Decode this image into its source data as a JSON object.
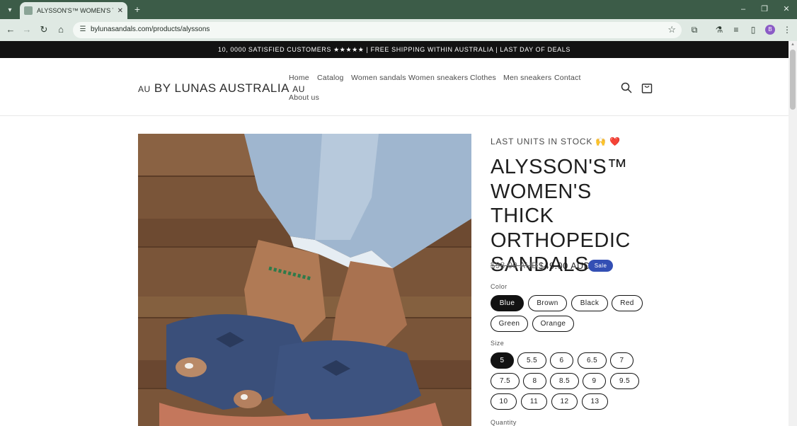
{
  "browser": {
    "tab_title": "ALYSSON'S™ WOMEN'S THICK",
    "tab_close": "✕",
    "new_tab": "+",
    "url": "bylunasandals.com/products/alyssons",
    "profile_initial": "B"
  },
  "announcement": "10, 0000 SATISFIED CUSTOMERS ★★★★★ | FREE SHIPPING WITHIN AUSTRALIA | LAST DAY OF DEALS",
  "header": {
    "logo_prefix": "AU",
    "logo_main": "BY LUNAS AUSTRALIA",
    "logo_suffix": "AU",
    "nav": [
      "Home",
      "Catalog",
      "Women sandals",
      "Women sneakers",
      "Clothes",
      "Men sneakers",
      "Contact",
      "About us"
    ]
  },
  "product": {
    "stock_note": "LAST UNITS IN STOCK 🙌 ❤️",
    "title": "ALYSSON'S™ WOMEN'S THICK ORTHOPEDIC SANDALS",
    "price_old": "$98.00 AUD",
    "price_new": "$49.00 AUD",
    "sale_badge": "Sale",
    "color_label": "Color",
    "colors": [
      "Blue",
      "Brown",
      "Black",
      "Red",
      "Green",
      "Orange"
    ],
    "color_selected": "Blue",
    "size_label": "Size",
    "sizes": [
      "5",
      "5.5",
      "6",
      "6.5",
      "7",
      "7.5",
      "8",
      "8.5",
      "9",
      "9.5",
      "10",
      "11",
      "12",
      "13"
    ],
    "size_selected": "5",
    "quantity_label": "Quantity"
  },
  "icons": {
    "tab_list": "chevron-down-icon",
    "back": "arrow-left-icon",
    "forward": "arrow-right-icon",
    "reload": "reload-icon",
    "home": "home-icon",
    "site_info": "tune-icon",
    "bookmark": "star-icon",
    "extensions": "puzzle-icon",
    "search": "search-icon",
    "cart": "cart-icon"
  },
  "colors": {
    "tabstrip": "#3c5c48",
    "toolbar": "#dfe9e3",
    "announcement_bg": "#121212",
    "sale_badge": "#334fb4"
  }
}
